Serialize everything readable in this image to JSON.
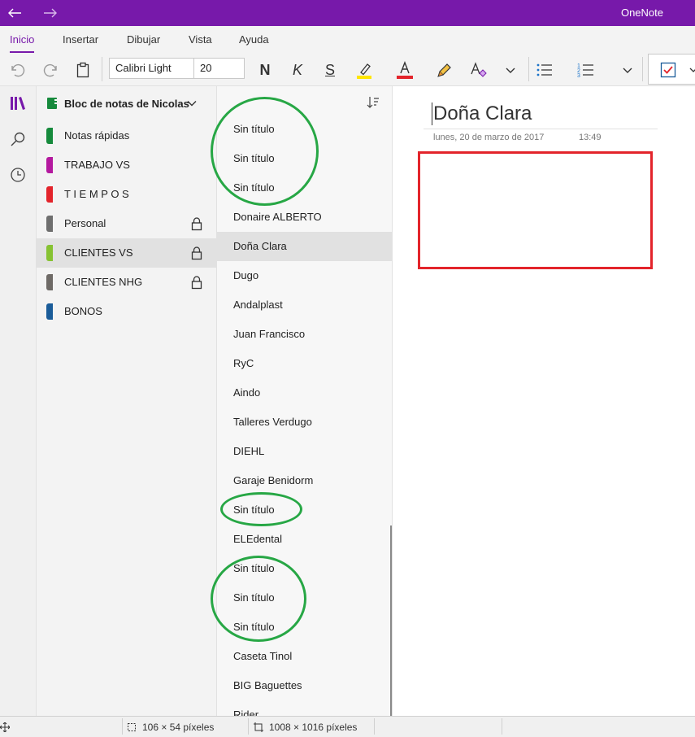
{
  "titlebar": {
    "app_name": "OneNote"
  },
  "ribbon": {
    "tabs": [
      {
        "label": "Inicio",
        "active": true
      },
      {
        "label": "Insertar",
        "active": false
      },
      {
        "label": "Dibujar",
        "active": false
      },
      {
        "label": "Vista",
        "active": false
      },
      {
        "label": "Ayuda",
        "active": false
      }
    ],
    "font_name": "Calibri Light",
    "font_size": "20",
    "bold_glyph": "N",
    "italic_glyph": "K",
    "strike_glyph": "S",
    "font_color_glyph": "A",
    "highlight_color": "#ffe600",
    "font_color": "#e3242b"
  },
  "notebook": {
    "title": "Bloc de notas de Nicolas"
  },
  "sections": [
    {
      "label": "Notas rápidas",
      "color": "#168a3c",
      "locked": false,
      "selected": false
    },
    {
      "label": "TRABAJO VS",
      "color": "#b4199f",
      "locked": false,
      "selected": false
    },
    {
      "label": "T I E M P O S",
      "color": "#e3242b",
      "locked": false,
      "selected": false
    },
    {
      "label": "Personal",
      "color": "#6e6e6e",
      "locked": true,
      "selected": false
    },
    {
      "label": "CLIENTES VS",
      "color": "#86c232",
      "locked": true,
      "selected": true
    },
    {
      "label": "CLIENTES NHG",
      "color": "#6e6a66",
      "locked": true,
      "selected": false
    },
    {
      "label": "BONOS",
      "color": "#1a5c99",
      "locked": false,
      "selected": false
    }
  ],
  "pages": [
    "Sin título",
    "Sin título",
    "Sin título",
    "Donaire ALBERTO",
    "Doña Clara",
    "Dugo",
    "Andalplast",
    "Juan Francisco",
    "RyC",
    "Aindo",
    "Talleres Verdugo",
    "DIEHL",
    "Garaje Benidorm",
    "Sin título",
    "ELEdental",
    "Sin título",
    "Sin título",
    "Sin título",
    "Caseta Tinol",
    "BIG Baguettes",
    "Rider"
  ],
  "selected_page_index": 4,
  "canvas": {
    "title": "Doña Clara",
    "date": "lunes, 20 de marzo de 2017",
    "time": "13:49"
  },
  "statusbar": {
    "selection_size": "106 × 54 píxeles",
    "image_size": "1008 × 1016 píxeles"
  },
  "annotation_colors": {
    "rectangle": "#e3242b",
    "ellipse": "#27a745"
  }
}
